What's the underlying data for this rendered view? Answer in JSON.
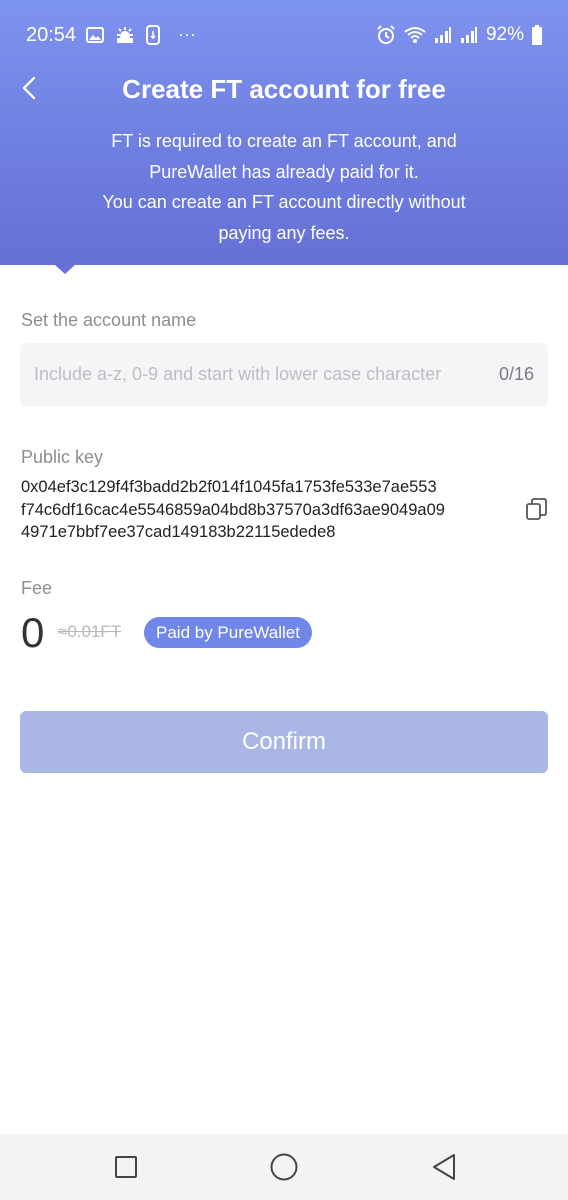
{
  "status_bar": {
    "time": "20:54",
    "battery": "92%",
    "more_indicator": "···",
    "left_icons": [
      "image-icon",
      "weather-icon",
      "screen-record-icon"
    ],
    "right_icons": [
      "alarm-icon",
      "wifi-icon",
      "signal-icon",
      "signal-icon",
      "battery-icon"
    ]
  },
  "header": {
    "title": "Create FT account for free",
    "description_lines": [
      "FT is required to create an FT account, and",
      "PureWallet has already paid for it.",
      "You can create an FT account directly without",
      "paying any fees."
    ],
    "back_icon": "chevron-left-icon",
    "gradient_colors": [
      "#7f93f0",
      "#6670d6"
    ]
  },
  "account_name": {
    "label": "Set the account name",
    "placeholder": "Include a-z, 0-9 and start with lower case character",
    "value": "",
    "counter": "0/16"
  },
  "public_key": {
    "label": "Public key",
    "lines": [
      "0x04ef3c129f4f3badd2b2f014f1045fa1753fe533e7ae553",
      "f74c6df16cac4e5546859a04bd8b37570a3df63ae9049a09",
      "4971e7bbf7ee37cad149183b22115edede8"
    ],
    "copy_icon": "copy-icon"
  },
  "fee": {
    "label": "Fee",
    "amount": "0",
    "original": "≈0.01FT",
    "badge": "Paid by PureWallet",
    "badge_color": "#7086e8"
  },
  "confirm": {
    "label": "Confirm",
    "color": "#a9b6e6"
  },
  "nav_bar": {
    "icons": [
      "recent-apps-icon",
      "home-icon",
      "back-icon"
    ]
  }
}
